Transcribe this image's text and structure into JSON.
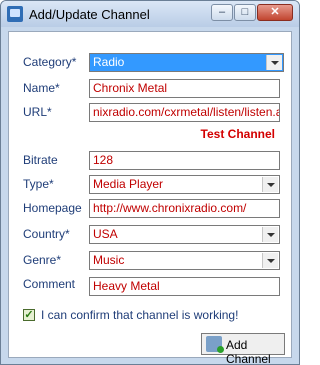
{
  "window": {
    "title": "Add/Update Channel",
    "icon": "app-window-icon"
  },
  "titlebar_buttons": {
    "minimize": "–",
    "maximize": "□",
    "close": "✕"
  },
  "form": {
    "category": {
      "label": "Category*",
      "value": "Radio"
    },
    "name": {
      "label": "Name*",
      "value": "Chronix Metal"
    },
    "url": {
      "label": "URL*",
      "value": "nixradio.com/cxrmetal/listen/listen.asx"
    },
    "test_channel": "Test Channel",
    "bitrate": {
      "label": "Bitrate",
      "value": "128"
    },
    "type": {
      "label": "Type*",
      "value": "Media Player"
    },
    "homepage": {
      "label": "Homepage",
      "value": "http://www.chronixradio.com/"
    },
    "country": {
      "label": "Country*",
      "value": "USA"
    },
    "genre": {
      "label": "Genre*",
      "value": "Music"
    },
    "comment": {
      "label": "Comment",
      "value": "Heavy Metal"
    },
    "confirm_checkbox": {
      "label": "I can confirm that channel is working!",
      "checked": true
    },
    "add_button": "Add Channel"
  },
  "colors": {
    "label": "#1f3d78",
    "value": "#c00000",
    "accent": "#d30000",
    "selection": "#3399ff"
  }
}
